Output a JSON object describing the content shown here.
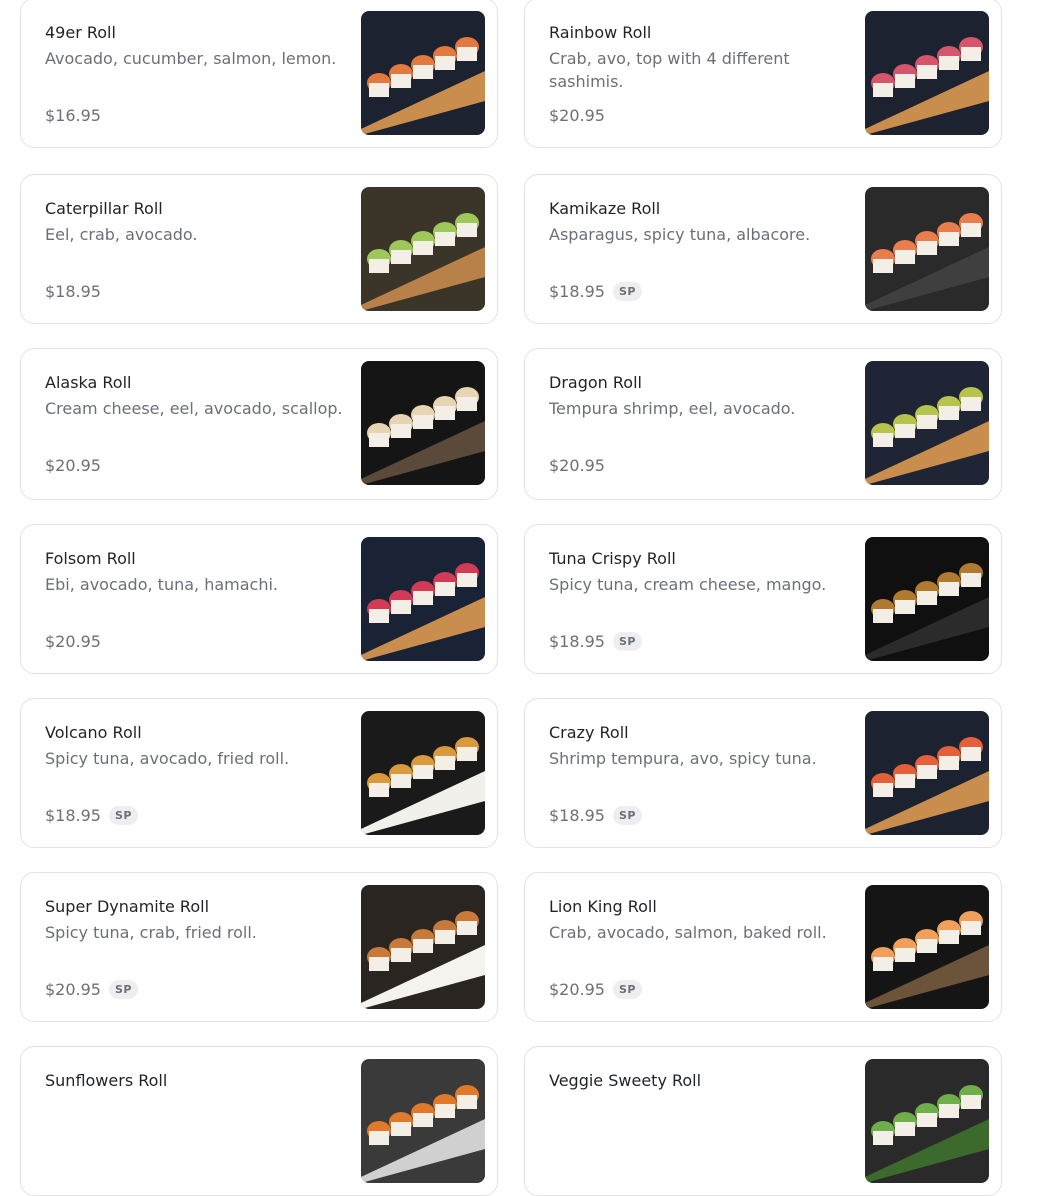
{
  "menu_items": [
    {
      "name": "49er Roll",
      "description": "Avocado, cucumber, salmon, lemon.",
      "price": "$16.95",
      "badge": "",
      "image": "salmon-roll-on-wood-board"
    },
    {
      "name": "Rainbow Roll",
      "description": "Crab, avo, top with 4 different sashimis.",
      "price": "$20.95",
      "badge": "",
      "image": "rainbow-roll-on-wood-board"
    },
    {
      "name": "Caterpillar Roll",
      "description": "Eel, crab, avocado.",
      "price": "$18.95",
      "badge": "",
      "image": "avocado-topped-roll-on-wood-board"
    },
    {
      "name": "Kamikaze Roll",
      "description": "Asparagus, spicy tuna, albacore.",
      "price": "$18.95",
      "badge": "SP",
      "image": "albacore-roll-on-slate"
    },
    {
      "name": "Alaska Roll",
      "description": "Cream cheese, eel, avocado, scallop.",
      "price": "$20.95",
      "badge": "",
      "image": "baked-roll-on-dark-plate"
    },
    {
      "name": "Dragon Roll",
      "description": "Tempura shrimp, eel, avocado.",
      "price": "$20.95",
      "badge": "",
      "image": "dragon-roll-on-wood-board"
    },
    {
      "name": "Folsom Roll",
      "description": "Ebi, avocado, tuna, hamachi.",
      "price": "$20.95",
      "badge": "",
      "image": "tuna-roll-on-wood-board"
    },
    {
      "name": "Tuna Crispy Roll",
      "description": "Spicy tuna, cream cheese, mango.",
      "price": "$18.95",
      "badge": "SP",
      "image": "crispy-roll-with-orchid"
    },
    {
      "name": "Volcano Roll",
      "description": "Spicy tuna, avocado, fried roll.",
      "price": "$18.95",
      "badge": "SP",
      "image": "volcano-roll-in-bowl"
    },
    {
      "name": "Crazy Roll",
      "description": "Shrimp tempura, avo, spicy tuna.",
      "price": "$18.95",
      "badge": "SP",
      "image": "spicy-roll-on-wood-board"
    },
    {
      "name": "Super Dynamite Roll",
      "description": "Spicy tuna, crab, fried roll.",
      "price": "$20.95",
      "badge": "SP",
      "image": "fried-roll-on-white-plate"
    },
    {
      "name": "Lion King Roll",
      "description": "Crab, avocado, salmon, baked roll.",
      "price": "$20.95",
      "badge": "SP",
      "image": "baked-salmon-roll-on-plate"
    },
    {
      "name": "Sunflowers Roll",
      "description": "",
      "price": "",
      "badge": "",
      "image": "sunflower-roll"
    },
    {
      "name": "Veggie Sweety Roll",
      "description": "",
      "price": "",
      "badge": "",
      "image": "veggie-roll"
    }
  ],
  "colors": {
    "card_border": "#e3e3e6",
    "muted_text": "#6b7078",
    "badge_bg": "#eeeef0"
  }
}
